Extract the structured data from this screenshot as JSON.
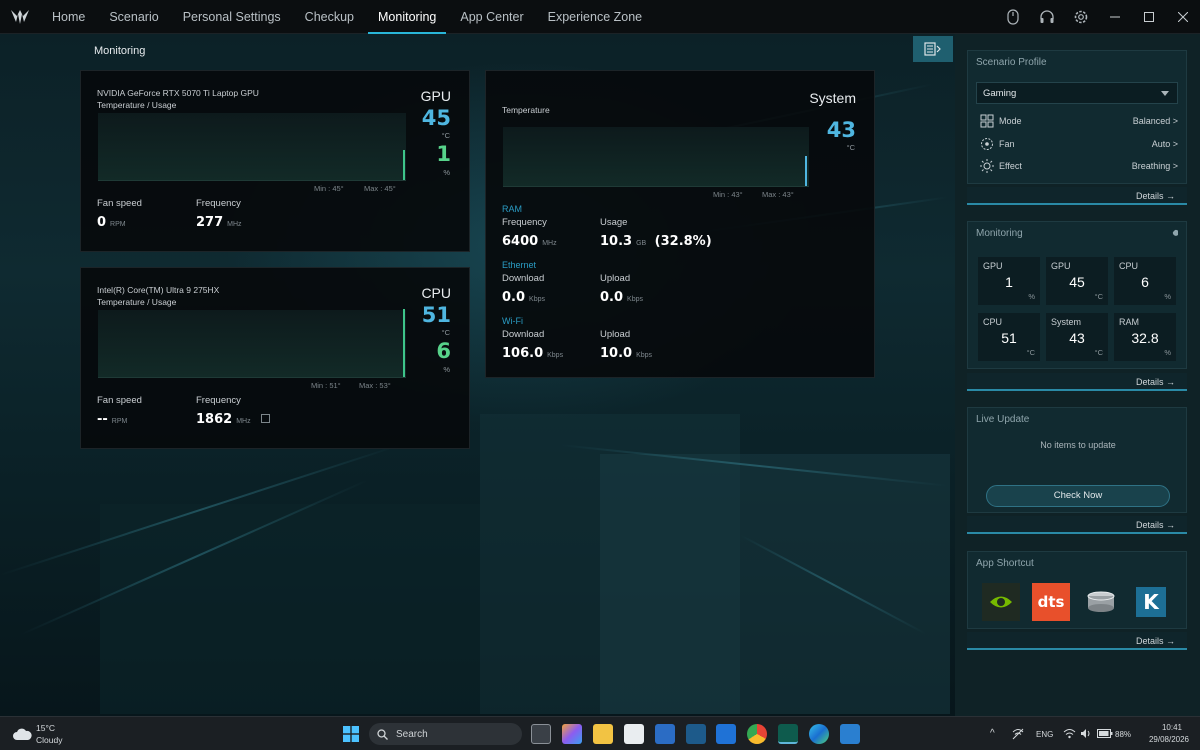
{
  "nav": {
    "items": [
      "Home",
      "Scenario",
      "Personal Settings",
      "Checkup",
      "Monitoring",
      "App Center",
      "Experience Zone"
    ],
    "active_index": 4
  },
  "page_title": "Monitoring",
  "gpu_card": {
    "name": "NVIDIA GeForce RTX 5070 Ti Laptop GPU",
    "subtitle": "Temperature / Usage",
    "title": "GPU",
    "temp": "45",
    "temp_unit": "°C",
    "usage": "1",
    "usage_unit": "%",
    "min": "Min : 45°",
    "max": "Max : 45°",
    "fan_label": "Fan speed",
    "fan_value": "0",
    "fan_unit": "RPM",
    "freq_label": "Frequency",
    "freq_value": "277",
    "freq_unit": "MHz"
  },
  "cpu_card": {
    "name": "Intel(R) Core(TM) Ultra 9 275HX",
    "subtitle": "Temperature / Usage",
    "title": "CPU",
    "temp": "51",
    "temp_unit": "°C",
    "usage": "6",
    "usage_unit": "%",
    "min": "Min : 51°",
    "max": "Max : 53°",
    "fan_label": "Fan speed",
    "fan_value": "--",
    "fan_unit": "RPM",
    "freq_label": "Frequency",
    "freq_value": "1862",
    "freq_unit": "MHz"
  },
  "system_card": {
    "title": "System",
    "subtitle": "Temperature",
    "temp": "43",
    "temp_unit": "°C",
    "min": "Min : 43°",
    "max": "Max : 43°",
    "ram": {
      "section": "RAM",
      "freq_label": "Frequency",
      "freq_value": "6400",
      "freq_unit": "MHz",
      "usage_label": "Usage",
      "usage_value": "10.3",
      "usage_unit": "GB",
      "usage_pct": "(32.8%)"
    },
    "ethernet": {
      "section": "Ethernet",
      "down_label": "Download",
      "down_value": "0.0",
      "down_unit": "Kbps",
      "up_label": "Upload",
      "up_value": "0.0",
      "up_unit": "Kbps"
    },
    "wifi": {
      "section": "Wi-Fi",
      "down_label": "Download",
      "down_value": "106.0",
      "down_unit": "Kbps",
      "up_label": "Upload",
      "up_value": "10.0",
      "up_unit": "Kbps"
    }
  },
  "scenario_profile": {
    "title": "Scenario Profile",
    "selected": "Gaming",
    "rows": [
      {
        "name": "Mode",
        "value": "Balanced >",
        "icon": "grid-icon"
      },
      {
        "name": "Fan",
        "value": "Auto >",
        "icon": "fan-icon"
      },
      {
        "name": "Effect",
        "value": "Breathing >",
        "icon": "sun-icon"
      }
    ],
    "details": "Details →"
  },
  "monitoring_panel": {
    "title": "Monitoring",
    "tiles": [
      {
        "label": "GPU",
        "value": "1",
        "unit": "%"
      },
      {
        "label": "GPU",
        "value": "45",
        "unit": "°C"
      },
      {
        "label": "CPU",
        "value": "6",
        "unit": "%"
      },
      {
        "label": "CPU",
        "value": "51",
        "unit": "°C"
      },
      {
        "label": "System",
        "value": "43",
        "unit": "°C"
      },
      {
        "label": "RAM",
        "value": "32.8",
        "unit": "%"
      }
    ],
    "details": "Details →"
  },
  "live_update": {
    "title": "Live Update",
    "message": "No items to update",
    "button": "Check Now",
    "details": "Details →"
  },
  "app_shortcut": {
    "title": "App Shortcut",
    "apps": [
      "nvidia-icon",
      "dts-icon",
      "coin-icon",
      "k-icon"
    ],
    "dts_text": "dts",
    "k_text": "K",
    "details": "Details →"
  },
  "taskbar": {
    "weather_temp": "15°C",
    "weather_text": "Cloudy",
    "search": "Search",
    "lang": "ENG",
    "battery": "88%",
    "time": "10:41",
    "date": "29/08/2026"
  },
  "colors": {
    "accent": "#29b6d8",
    "temp_blue": "#4fb6e0",
    "usage_green": "#57d28a"
  }
}
